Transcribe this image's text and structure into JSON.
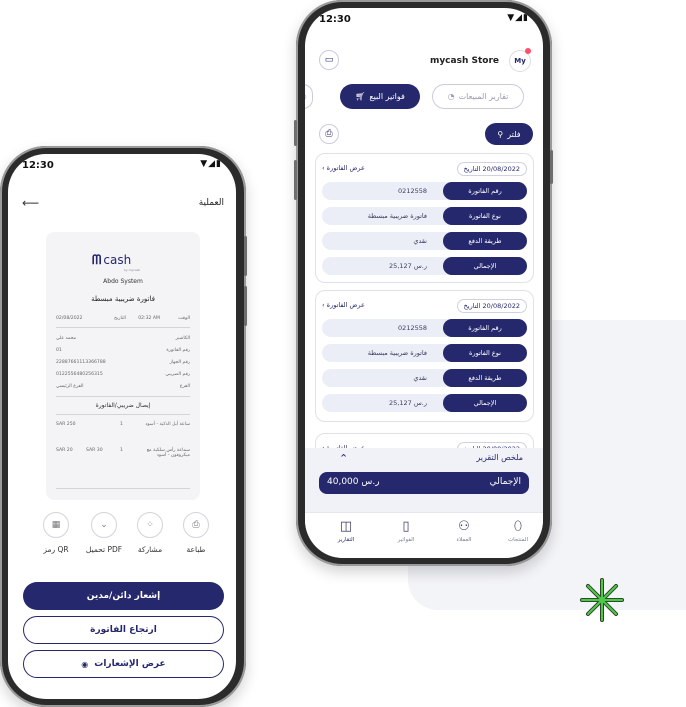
{
  "right_phone": {
    "status": {
      "time": "12:30",
      "icons": "▼◢▮"
    },
    "header": {
      "store_name": "mycash Store",
      "logo_text": "My"
    },
    "tabs": [
      {
        "label": "فواتير البيع"
      },
      {
        "label": "تقارير المبيعات"
      }
    ],
    "filter": {
      "label": "فلتر"
    },
    "invoice_labels": {
      "date_prefix": "التاريخ",
      "view": "عرض الفاتورة",
      "number": "رقم الفاتورة",
      "type": "نوع الفاتورة",
      "payment": "طريقة الدفع",
      "total": "الإجمالي"
    },
    "invoices": [
      {
        "date": "20/08/2022",
        "number": "0212558",
        "type": "فاتورة ضريبية مبسطة",
        "payment": "نقدي",
        "total": "25,127 ر.س"
      },
      {
        "date": "20/08/2022",
        "number": "0212558",
        "type": "فاتورة ضريبية مبسطة",
        "payment": "نقدي",
        "total": "25,127 ر.س"
      },
      {
        "date": "20/08/2022"
      }
    ],
    "summary": {
      "title": "ملخص التقرير",
      "total_label": "الإجمالي",
      "total_value": "40,000 ر.س"
    },
    "tabbar": [
      {
        "label": "المنتجات",
        "icon": "product-icon"
      },
      {
        "label": "العملاء",
        "icon": "customers-icon"
      },
      {
        "label": "الفواتير",
        "icon": "invoices-icon"
      },
      {
        "label": "التقارير",
        "icon": "reports-icon"
      }
    ]
  },
  "left_phone": {
    "status": {
      "time": "12:30",
      "icons": "▼◢▮"
    },
    "header": {
      "title": "العملية"
    },
    "receipt": {
      "brand": "cash",
      "brand_tag": "by mycash",
      "company": "Abdo System",
      "invoice_type": "فاتورة ضريبية مبسطة",
      "time_label": "الوقت",
      "time_value": "02:32 AM",
      "date_label": "التاريخ",
      "date_value": "02/08/2022",
      "fields": [
        {
          "label": "الكاشير",
          "value": "محمد علي"
        },
        {
          "label": "رقم الفاتورة",
          "value": "01"
        },
        {
          "label": "رقم الجهاز",
          "value": "22887661113366788"
        },
        {
          "label": "رقم الضريبي",
          "value": "0122556480256315"
        },
        {
          "label": "الفرع",
          "value": "الفرع الرئيسي"
        }
      ],
      "section_title": "إيصال ضريبي/الفاتورة",
      "items": [
        {
          "name": "ساعة أبل الذكية - أسود",
          "qty": "1",
          "price": "",
          "total": "SAR 250"
        },
        {
          "name": "سماعة رأس سلكية مع ميكروفون - أسود",
          "qty": "1",
          "price": "SAR 30",
          "total": "SAR 20"
        }
      ]
    },
    "actions": [
      {
        "label": "طباعة",
        "icon": "print-icon"
      },
      {
        "label": "مشاركة",
        "icon": "share-icon"
      },
      {
        "label": "تحميل PDF",
        "icon": "download-icon"
      },
      {
        "label": "رمز QR",
        "icon": "qr-icon"
      }
    ],
    "buttons": {
      "notice": "إشعار دائن/مدين",
      "return": "ارتجاع الفاتورة",
      "notifications": "عرض الإشعارات"
    }
  },
  "colors": {
    "primary": "#25286c",
    "accent_green": "#2bb673",
    "badge": "#ff4d6d"
  }
}
